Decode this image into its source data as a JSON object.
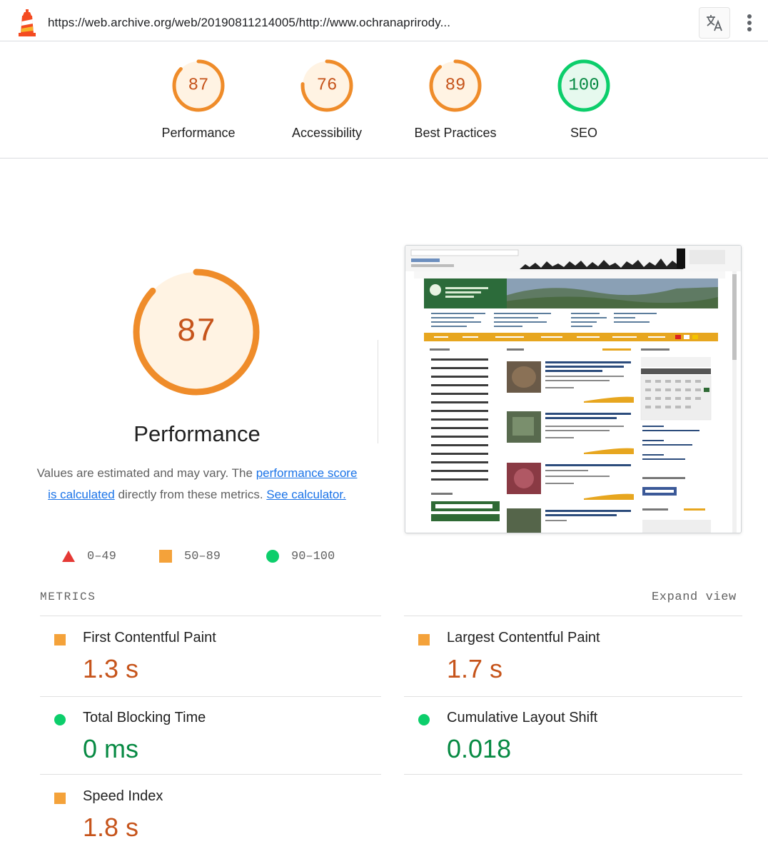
{
  "topbar": {
    "url": "https://web.archive.org/web/20190811214005/http://www.ochranaprirody..."
  },
  "colors": {
    "average": "#ef8c2a",
    "average_text": "#c6541b",
    "average_fill": "#fff3e3",
    "pass": "#0cce6b",
    "pass_text": "#078a43",
    "pass_fill": "#e6f9ee",
    "fail": "#e53935",
    "link": "#1a73e8"
  },
  "gauges": [
    {
      "score": "87",
      "label": "Performance",
      "rating": "average"
    },
    {
      "score": "76",
      "label": "Accessibility",
      "rating": "average"
    },
    {
      "score": "89",
      "label": "Best Practices",
      "rating": "average"
    },
    {
      "score": "100",
      "label": "SEO",
      "rating": "pass"
    }
  ],
  "performance": {
    "score": "87",
    "title": "Performance",
    "desc_text_1": "Values are estimated and may vary. The ",
    "desc_link_1": "performance score is calculated",
    "desc_text_2": " directly from these metrics. ",
    "desc_link_2": "See calculator."
  },
  "legend": [
    {
      "shape": "triangle",
      "range": "0–49"
    },
    {
      "shape": "square",
      "range": "50–89"
    },
    {
      "shape": "circle",
      "range": "90–100"
    }
  ],
  "metrics": {
    "header": "METRICS",
    "expand_label": "Expand view",
    "items": [
      {
        "name": "First Contentful Paint",
        "value": "1.3 s",
        "rating": "average"
      },
      {
        "name": "Largest Contentful Paint",
        "value": "1.7 s",
        "rating": "average"
      },
      {
        "name": "Total Blocking Time",
        "value": "0 ms",
        "rating": "pass"
      },
      {
        "name": "Cumulative Layout Shift",
        "value": "0.018",
        "rating": "pass"
      },
      {
        "name": "Speed Index",
        "value": "1.8 s",
        "rating": "average"
      }
    ]
  }
}
